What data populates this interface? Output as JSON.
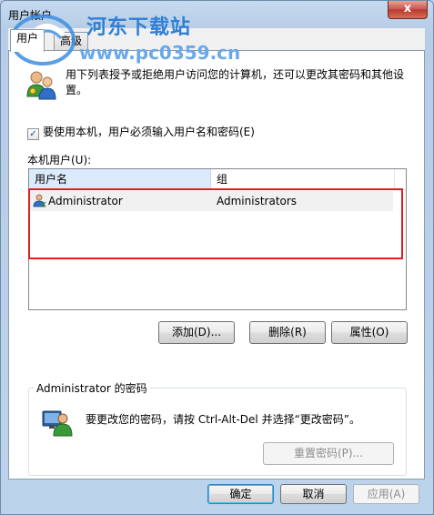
{
  "window": {
    "title": "用户帐户",
    "close_glyph": "x"
  },
  "watermark": {
    "brand": "河东下载站",
    "url": "www.pc0359.cn"
  },
  "tabs": [
    {
      "label": "用户",
      "active": true
    },
    {
      "label": "高级",
      "active": false
    }
  ],
  "description": "用下列表授予或拒绝用户访问您的计算机，还可以更改其密码和其他设置。",
  "require_login": {
    "label": "要使用本机，用户必须输入用户名和密码(E)",
    "checked": true,
    "check_glyph": "✓"
  },
  "local_users": {
    "label": "本机用户(U):",
    "columns": [
      "用户名",
      "组"
    ],
    "rows": [
      {
        "username": "Administrator",
        "group": "Administrators"
      }
    ]
  },
  "user_buttons": {
    "add": "添加(D)...",
    "remove": "删除(R)",
    "properties": "属性(O)"
  },
  "password_group": {
    "title": "Administrator 的密码",
    "text": "要更改您的密码，请按 Ctrl-Alt-Del 并选择“更改密码”。",
    "reset_button": "重置密码(P)..."
  },
  "dialog_buttons": {
    "ok": "确定",
    "cancel": "取消",
    "apply": "应用(A)"
  },
  "colors": {
    "accent": "#3c7fb1",
    "highlight": "#e02020",
    "header_selected": "#dcebfb"
  }
}
